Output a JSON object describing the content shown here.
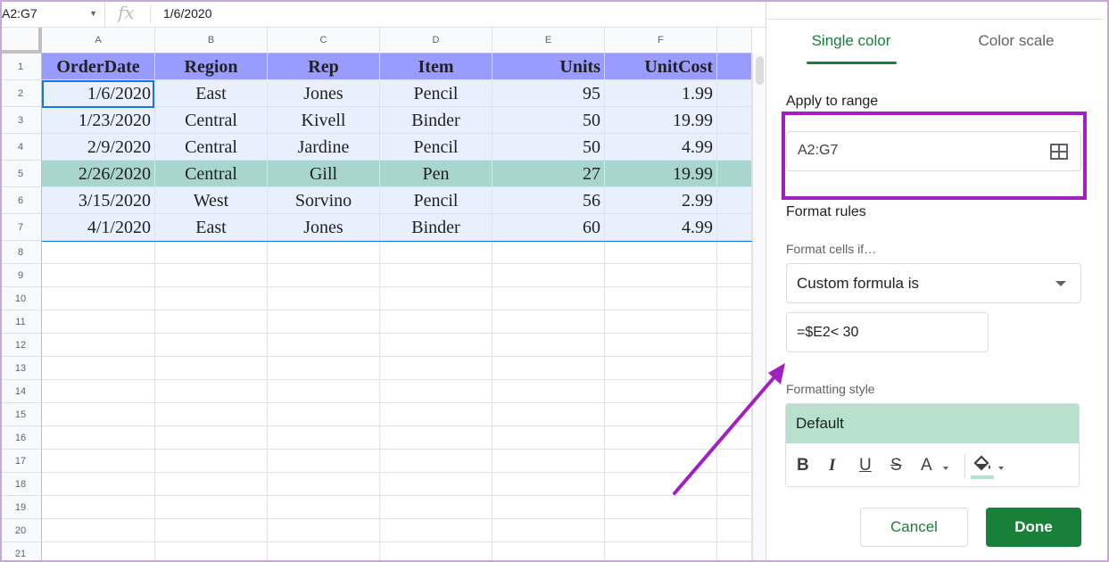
{
  "formula_bar": {
    "name_box": "A2:G7",
    "fx_symbol": "fx",
    "formula": "1/6/2020"
  },
  "grid": {
    "columns": [
      "A",
      "B",
      "C",
      "D",
      "E",
      "F"
    ],
    "rows": [
      "1",
      "2",
      "3",
      "4",
      "5",
      "6",
      "7",
      "8",
      "9",
      "10",
      "11",
      "12",
      "13",
      "14",
      "15",
      "16",
      "17",
      "18",
      "19",
      "20",
      "21"
    ],
    "header": [
      "OrderDate",
      "Region",
      "Rep",
      "Item",
      "Units",
      "UnitCost"
    ],
    "data": [
      [
        "1/6/2020",
        "East",
        "Jones",
        "Pencil",
        "95",
        "1.99"
      ],
      [
        "1/23/2020",
        "Central",
        "Kivell",
        "Binder",
        "50",
        "19.99"
      ],
      [
        "2/9/2020",
        "Central",
        "Jardine",
        "Pencil",
        "50",
        "4.99"
      ],
      [
        "2/26/2020",
        "Central",
        "Gill",
        "Pen",
        "27",
        "19.99"
      ],
      [
        "3/15/2020",
        "West",
        "Sorvino",
        "Pencil",
        "56",
        "2.99"
      ],
      [
        "4/1/2020",
        "East",
        "Jones",
        "Binder",
        "60",
        "4.99"
      ]
    ],
    "highlighted_row": 4
  },
  "panel": {
    "tabs": [
      "Single color",
      "Color scale"
    ],
    "active_tab": "Single color",
    "apply_to_range_label": "Apply to range",
    "range_value": "A2:G7",
    "format_rules_label": "Format rules",
    "format_cells_if_label": "Format cells if…",
    "condition": "Custom formula is",
    "formula_value": "=$E2< 30",
    "formatting_style_label": "Formatting style",
    "style_preview": "Default",
    "style_tools": {
      "bold": "B",
      "italic": "I",
      "underline": "U",
      "strike": "S",
      "text_color": "A"
    },
    "cancel_label": "Cancel",
    "done_label": "Done"
  },
  "colors": {
    "accent_green": "#188038",
    "header_fill": "#9a9bff",
    "selection_fill": "#e8f0fe",
    "highlight_fill": "#a8d5cd",
    "style_preview_fill": "#b7e1cd",
    "annotation_purple": "#a020c0"
  }
}
